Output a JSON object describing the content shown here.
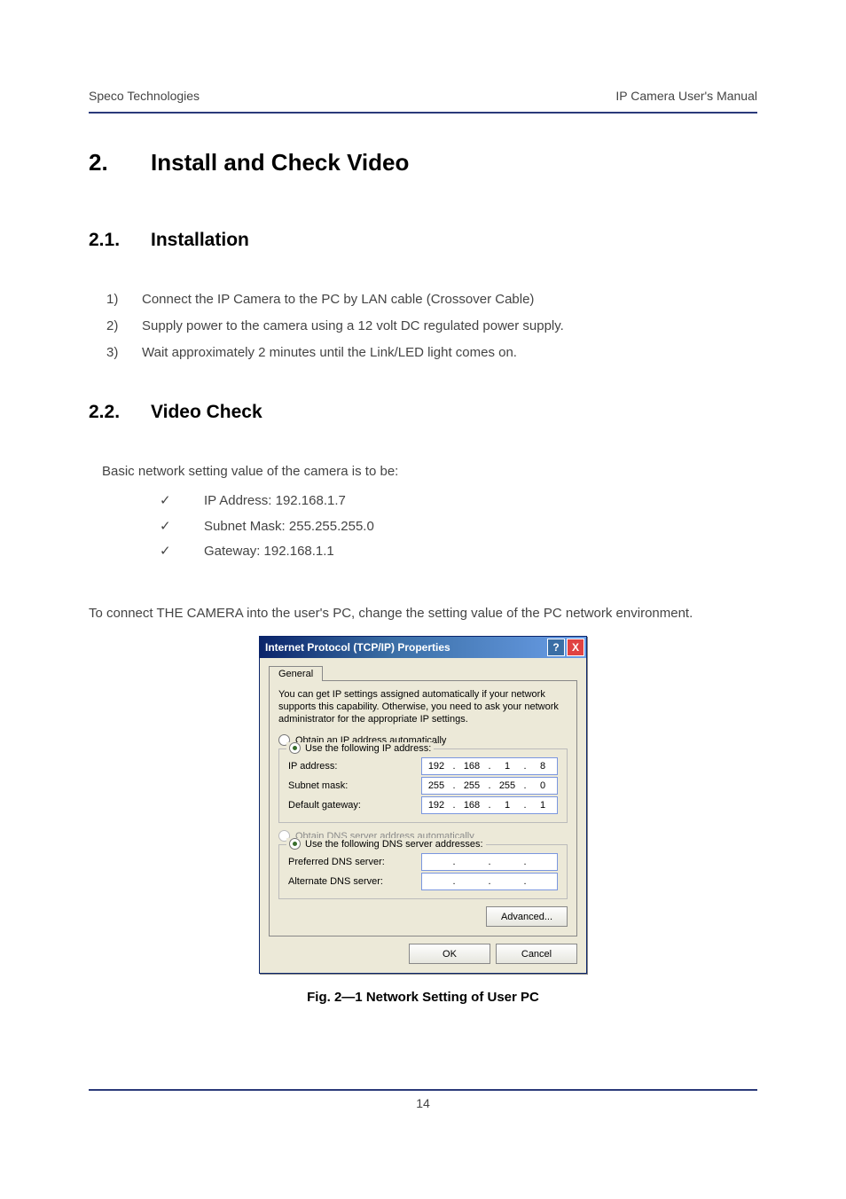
{
  "header": {
    "left": "Speco Technologies",
    "right": "IP Camera User's Manual"
  },
  "chapter": {
    "num": "2.",
    "title": "Install and Check Video"
  },
  "section1": {
    "num": "2.1.",
    "title": "Installation",
    "items": [
      {
        "m": "1)",
        "t": "Connect the IP Camera to the PC by LAN cable (Crossover Cable)"
      },
      {
        "m": "2)",
        "t": "Supply power to the camera using a 12 volt DC regulated power supply."
      },
      {
        "m": "3)",
        "t": "Wait approximately 2 minutes until the Link/LED light comes on."
      }
    ]
  },
  "section2": {
    "num": "2.2.",
    "title": "Video Check",
    "lead": "Basic network setting value of the camera is to be:",
    "checks": [
      "IP Address: 192.168.1.7",
      "Subnet Mask: 255.255.255.0",
      "Gateway: 192.168.1.1"
    ],
    "para": "To connect THE CAMERA into the user's PC, change the setting value of the PC network environment."
  },
  "dialog": {
    "title": "Internet Protocol (TCP/IP) Properties",
    "tab": "General",
    "desc": "You can get IP settings assigned automatically if your network supports this capability. Otherwise, you need to ask your network administrator for the appropriate IP settings.",
    "ip_auto": "Obtain an IP address automatically",
    "ip_manual": "Use the following IP address:",
    "ip_label": "IP address:",
    "ip_val": [
      "192",
      "168",
      "1",
      "8"
    ],
    "mask_label": "Subnet mask:",
    "mask_val": [
      "255",
      "255",
      "255",
      "0"
    ],
    "gw_label": "Default gateway:",
    "gw_val": [
      "192",
      "168",
      "1",
      "1"
    ],
    "dns_auto": "Obtain DNS server address automatically",
    "dns_manual": "Use the following DNS server addresses:",
    "pdns_label": "Preferred DNS server:",
    "adns_label": "Alternate DNS server:",
    "advanced": "Advanced...",
    "ok": "OK",
    "cancel": "Cancel"
  },
  "caption": "Fig. 2—1   Network Setting of User PC",
  "page_number": "14"
}
